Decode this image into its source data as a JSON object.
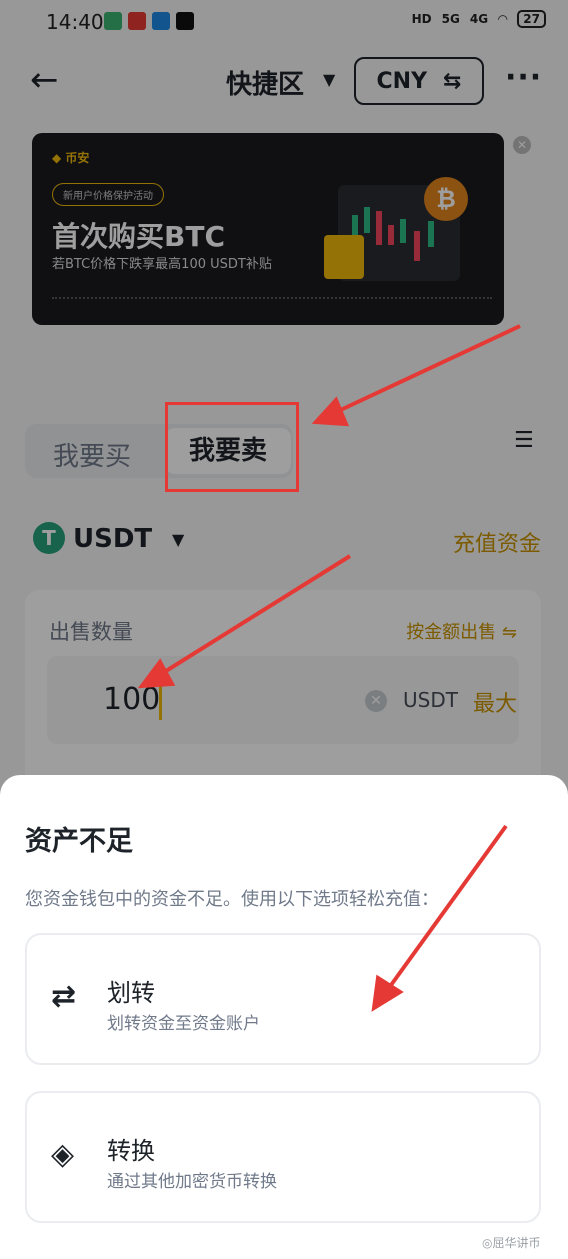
{
  "status": {
    "time": "14:40",
    "battery": "27",
    "net1": "HD",
    "net2": "5G",
    "net3": "4G"
  },
  "header": {
    "title": "快捷区",
    "currency": "CNY",
    "currency_icon": "⇆"
  },
  "banner": {
    "brand": "币安",
    "tag": "新用户价格保护活动",
    "headline": "首次购买BTC",
    "subline": "若BTC价格下跌享最高100 USDT补贴"
  },
  "tabs": {
    "buy": "我要买",
    "sell": "我要卖"
  },
  "asset": {
    "coin": "USDT",
    "deposit": "充值资金"
  },
  "form": {
    "qty_label": "出售数量",
    "by_amount": "按金额出售 ⇋",
    "value": "100",
    "unit": "USDT",
    "max": "最大"
  },
  "sheet": {
    "title": "资产不足",
    "desc": "您资金钱包中的资金不足。使用以下选项轻松充值：",
    "options": [
      {
        "title": "划转",
        "subtitle": "划转资金至资金账户"
      },
      {
        "title": "转换",
        "subtitle": "通过其他加密货币转换"
      }
    ]
  },
  "watermark": "◎屈华讲币",
  "colors": {
    "accent": "#c99400",
    "brand_yellow": "#f0b90b",
    "annotation_red": "#e53935",
    "tether_green": "#26a17b"
  }
}
